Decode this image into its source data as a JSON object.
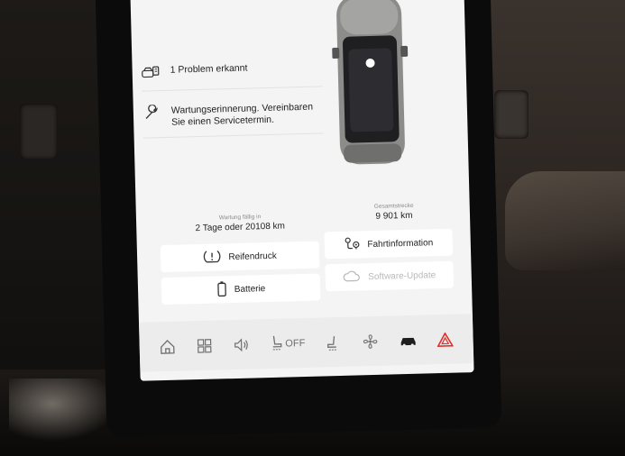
{
  "status": {
    "problem_text": "1 Problem erkannt",
    "service_text": "Wartungserinnerung. Vereinbaren Sie einen Servicetermin."
  },
  "metrics": {
    "service_caption": "Wartung fällig in",
    "service_value": "2 Tage oder 20108 km",
    "odometer_caption": "Gesamtstrecke",
    "odometer_value": "9 901 km"
  },
  "tiles": {
    "tire_pressure": "Reifendruck",
    "trip_info": "Fahrtinformation",
    "battery": "Batterie",
    "software_update": "Software-Update"
  },
  "navbar": {
    "seat_heat_label": "OFF",
    "items": [
      "home-icon",
      "apps-icon",
      "volume-icon",
      "seat-heat-icon",
      "seat-vent-icon",
      "fan-icon",
      "car-icon",
      "hazard-icon"
    ]
  },
  "colors": {
    "screen_bg": "#f4f4f4",
    "hazard": "#e0302b",
    "text": "#1e1e1e",
    "disabled": "#b9b9b9"
  }
}
